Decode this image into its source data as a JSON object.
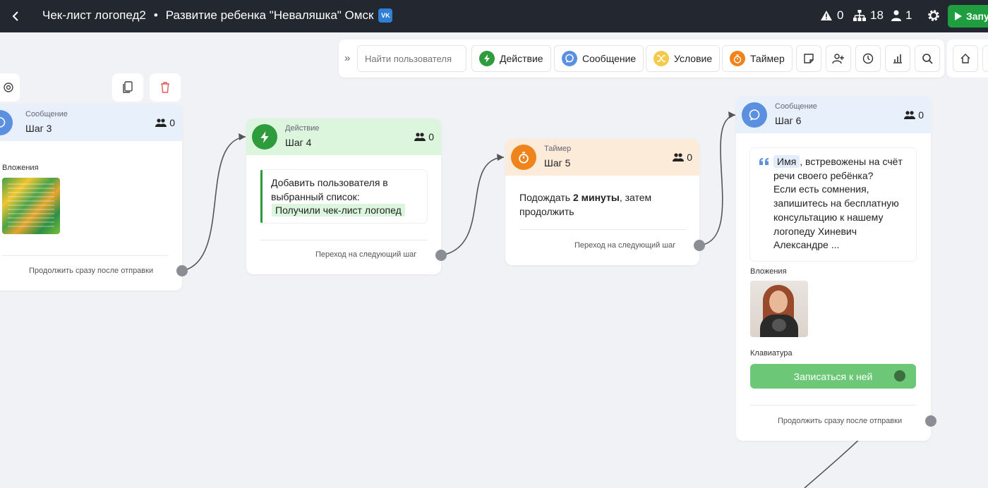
{
  "header": {
    "title_left": "Чек-лист логопед2",
    "separator": "•",
    "title_right": "Развитие ребенка \"Неваляшка\" Омск",
    "vk_badge": "VK",
    "warnings": "0",
    "structure": "18",
    "users": "1",
    "run_label": "Запу"
  },
  "toolbar": {
    "search_placeholder": "Найти пользователя",
    "action": "Действие",
    "message": "Сообщение",
    "condition": "Условие",
    "timer": "Таймер"
  },
  "cards": {
    "step3": {
      "type": "Сообщение",
      "name": "Шаг 3",
      "count": "0",
      "attachments_label": "Вложения",
      "footer": "Продолжить сразу после отправки"
    },
    "step4": {
      "type": "Действие",
      "name": "Шаг 4",
      "count": "0",
      "line1": "Добавить пользователя в",
      "line2": "выбранный список:",
      "list_name": "Получили чек-лист логопед",
      "footer": "Переход на следующий шаг"
    },
    "step5": {
      "type": "Таймер",
      "name": "Шаг 5",
      "count": "0",
      "text_before": "Подождать ",
      "text_bold": "2 минуты",
      "text_after": ", затем",
      "text_line2": "продолжить",
      "footer": "Переход на следующий шаг"
    },
    "step6": {
      "type": "Сообщение",
      "name": "Шаг 6",
      "count": "0",
      "name_tag": "Имя",
      "msg_first": ", встревожены на счёт",
      "msg_lines": [
        "речи своего ребёнка?",
        "Если есть сомнения,",
        "запишитесь на бесплатную",
        "консультацию к нашему",
        "логопеду Хиневич",
        "Александре ..."
      ],
      "attachments_label": "Вложения",
      "keyboard_label": "Клавиатура",
      "button_label": "Записаться к ней",
      "footer": "Продолжить сразу после отправки"
    }
  },
  "colors": {
    "message_blue": "#5b8fe0",
    "action_green": "#2e9b3c",
    "timer_orange": "#f0841c",
    "condition_yellow": "#f5c94a",
    "keyboard_button": "#6cc877"
  }
}
